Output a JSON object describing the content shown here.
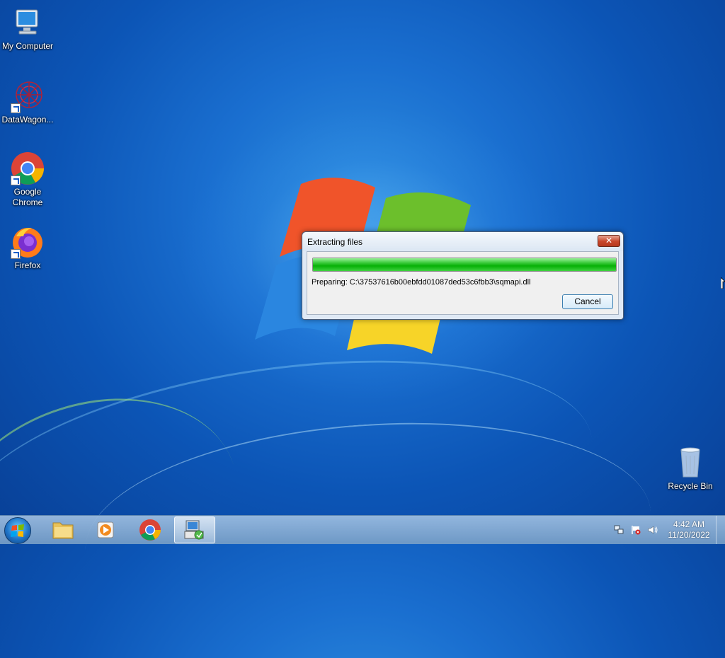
{
  "desktop": {
    "icons": [
      {
        "label": "My Computer",
        "icon": "computer-icon"
      },
      {
        "label": "DataWagon...",
        "icon": "datawagon-icon"
      },
      {
        "label": "Google Chrome",
        "icon": "chrome-icon"
      },
      {
        "label": "Firefox",
        "icon": "firefox-icon"
      },
      {
        "label": "Recycle Bin",
        "icon": "recycle-bin-icon"
      }
    ]
  },
  "dialog": {
    "title": "Extracting files",
    "close_label": "✕",
    "progress": 1.0,
    "status": "Preparing: C:\\37537616b00ebfdd01087ded53c6fbb3\\sqmapi.dll",
    "cancel_label": "Cancel"
  },
  "taskbar": {
    "items": [
      {
        "name": "file-explorer",
        "icon": "folder-icon"
      },
      {
        "name": "media-player",
        "icon": "media-player-icon"
      },
      {
        "name": "chrome",
        "icon": "chrome-icon"
      },
      {
        "name": "installer",
        "icon": "installer-icon",
        "active": true
      }
    ],
    "tray": [
      "network-icon",
      "action-center-icon",
      "volume-icon"
    ],
    "time": "4:42 AM",
    "date": "11/20/2022"
  },
  "colors": {
    "progress": "#06b006",
    "close_button": "#c7462a",
    "desktop": "#1a6fd0"
  }
}
